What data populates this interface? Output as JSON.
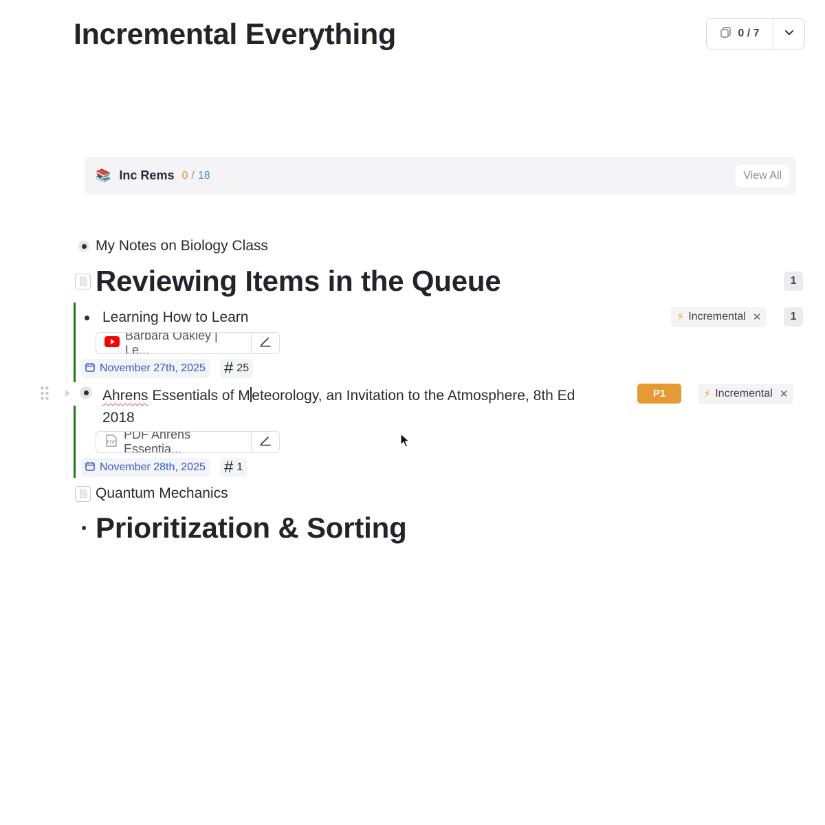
{
  "document": {
    "title": "Incremental Everything"
  },
  "card_counter": {
    "value": "0 / 7",
    "icon": "cards-icon",
    "dropdown_icon": "chevron-down-icon"
  },
  "inc_rems": {
    "emoji": "📚",
    "label": "Inc Rems",
    "count_done": "0",
    "count_sep": "/",
    "count_total": "18",
    "view_all": "View All",
    "colors": {
      "done": "#e0913a",
      "total": "#4f86d9"
    }
  },
  "outline": {
    "biology": {
      "text": "My Notes on Biology Class"
    },
    "reviewing": {
      "text": "Reviewing Items in the Queue",
      "badge": "1"
    },
    "learning": {
      "text": "Learning How to Learn",
      "tag": "Incremental",
      "badge": "1",
      "source": "Barbara Oakley | Le...",
      "source_icon": "youtube-icon",
      "date": "November 27th, 2025",
      "hash_count": "25"
    },
    "ahrens": {
      "text_misspelled": "Ahrens",
      "text_before_caret": " Essentials of M",
      "text_after_caret": "eteorology, an Invitation to the Atmosphere, 8th Ed",
      "text_line2": "2018",
      "priority": "P1",
      "tag": "Incremental",
      "source": "PDF Ahrens Essentia...",
      "source_icon": "pdf-icon",
      "date": "November 28th, 2025",
      "hash_count": "1"
    },
    "quantum": {
      "text": "Quantum Mechanics"
    },
    "prioritization": {
      "text": "Prioritization & Sorting"
    }
  },
  "colors": {
    "accent_green": "#1f7a1a",
    "priority": "#e69a33",
    "date_blue": "#3558c8"
  }
}
